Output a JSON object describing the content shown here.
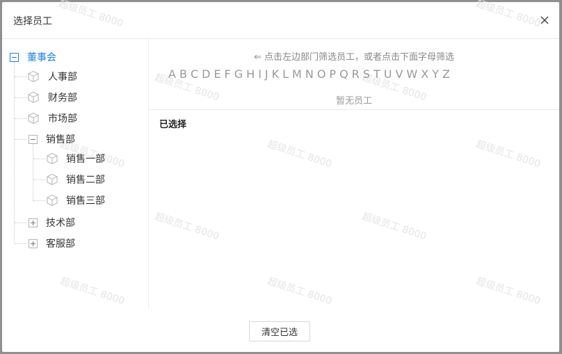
{
  "dialog": {
    "title": "选择员工",
    "close_icon": "close-icon"
  },
  "tree": {
    "root": {
      "label": "董事会",
      "expanded": true,
      "color": "#1e7fd8"
    },
    "items": [
      {
        "label": "人事部",
        "icon": "cube-icon"
      },
      {
        "label": "财务部",
        "icon": "cube-icon"
      },
      {
        "label": "市场部",
        "icon": "cube-icon"
      },
      {
        "label": "销售部",
        "expanded": true,
        "children": [
          {
            "label": "销售一部",
            "icon": "cube-icon"
          },
          {
            "label": "销售二部",
            "icon": "cube-icon"
          },
          {
            "label": "销售三部",
            "icon": "cube-icon"
          }
        ]
      },
      {
        "label": "技术部",
        "expanded": false
      },
      {
        "label": "客服部",
        "expanded": false
      }
    ]
  },
  "filter": {
    "hint": "⇐ 点击左边部门筛选员工，或者点击下面字母筛选",
    "letters": [
      "A",
      "B",
      "C",
      "D",
      "E",
      "F",
      "G",
      "H",
      "I",
      "J",
      "K",
      "L",
      "M",
      "N",
      "O",
      "P",
      "Q",
      "R",
      "S",
      "T",
      "U",
      "V",
      "W",
      "X",
      "Y",
      "Z"
    ],
    "empty": "暂无员工"
  },
  "selected": {
    "title": "已选择"
  },
  "footer": {
    "clear_label": "清空已选"
  },
  "watermark": "超级员工 8000"
}
